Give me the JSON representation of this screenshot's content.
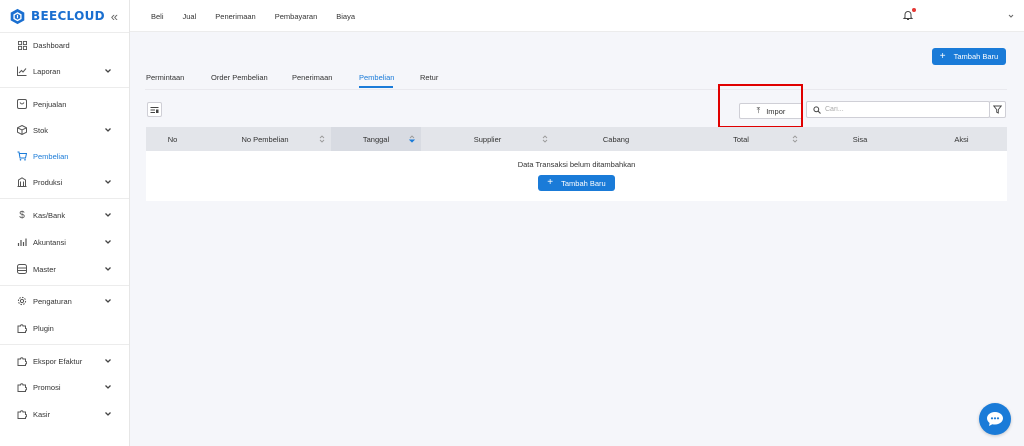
{
  "app": {
    "logo_text": "BEECLOUD"
  },
  "colors": {
    "accent": "#1a7bd8",
    "highlight": "#e00000",
    "notification": "#e53935"
  },
  "sidebar": {
    "items": [
      {
        "label": "Dashboard",
        "icon": "grid-icon"
      },
      {
        "label": "Laporan",
        "icon": "chart-line-icon",
        "has_submenu": true
      },
      {
        "label": "Penjualan",
        "icon": "receipt-icon"
      },
      {
        "label": "Stok",
        "icon": "box-icon",
        "has_submenu": true
      },
      {
        "label": "Pembelian",
        "icon": "cart-icon",
        "active": true
      },
      {
        "label": "Produksi",
        "icon": "factory-icon",
        "has_submenu": true
      },
      {
        "label": "Kas/Bank",
        "icon": "dollar-icon",
        "has_submenu": true
      },
      {
        "label": "Akuntansi",
        "icon": "bar-chart-icon",
        "has_submenu": true
      },
      {
        "label": "Master",
        "icon": "database-icon",
        "has_submenu": true
      },
      {
        "label": "Pengaturan",
        "icon": "gear-icon",
        "has_submenu": true
      },
      {
        "label": "Plugin",
        "icon": "puzzle-icon"
      },
      {
        "label": "Ekspor Efaktur",
        "icon": "puzzle-icon",
        "has_submenu": true
      },
      {
        "label": "Promosi",
        "icon": "puzzle-icon",
        "has_submenu": true
      },
      {
        "label": "Kasir",
        "icon": "puzzle-icon",
        "has_submenu": true
      }
    ]
  },
  "topnav": {
    "items": [
      "Beli",
      "Jual",
      "Penerimaan",
      "Pembayaran",
      "Biaya"
    ]
  },
  "main": {
    "add_button": "Tambah Baru",
    "tabs": [
      "Permintaan",
      "Order Pembelian",
      "Penerimaan",
      "Pembelian",
      "Retur"
    ],
    "active_tab": "Pembelian",
    "import_button": "Impor",
    "search_placeholder": "Cari...",
    "table": {
      "columns": [
        "No",
        "No Pembelian",
        "Tanggal",
        "Supplier",
        "Cabang",
        "Total",
        "Sisa",
        "Aksi"
      ],
      "empty_message": "Data Transaksi belum ditambahkan",
      "empty_add_button": "Tambah Baru"
    }
  }
}
